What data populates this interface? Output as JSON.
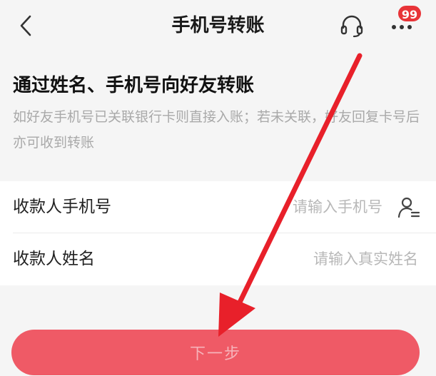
{
  "header": {
    "title": "手机号转账",
    "back_icon": "chevron-left-icon",
    "service_icon": "headset-icon",
    "more_icon": "more-dots-icon",
    "badge_count": "99"
  },
  "intro": {
    "title": "通过姓名、手机号向好友转账",
    "description": "如好友手机号已关联银行卡则直接入账；若未关联，好友回复卡号后亦可收到转账"
  },
  "form": {
    "phone": {
      "label": "收款人手机号",
      "placeholder": "请输入手机号",
      "value": ""
    },
    "name": {
      "label": "收款人姓名",
      "placeholder": "请输入真实姓名",
      "value": ""
    }
  },
  "next_button": {
    "label": "下一步"
  },
  "colors": {
    "accent": "#ef5a66",
    "badge": "#e83438",
    "annotation_arrow": "#e8202a"
  }
}
